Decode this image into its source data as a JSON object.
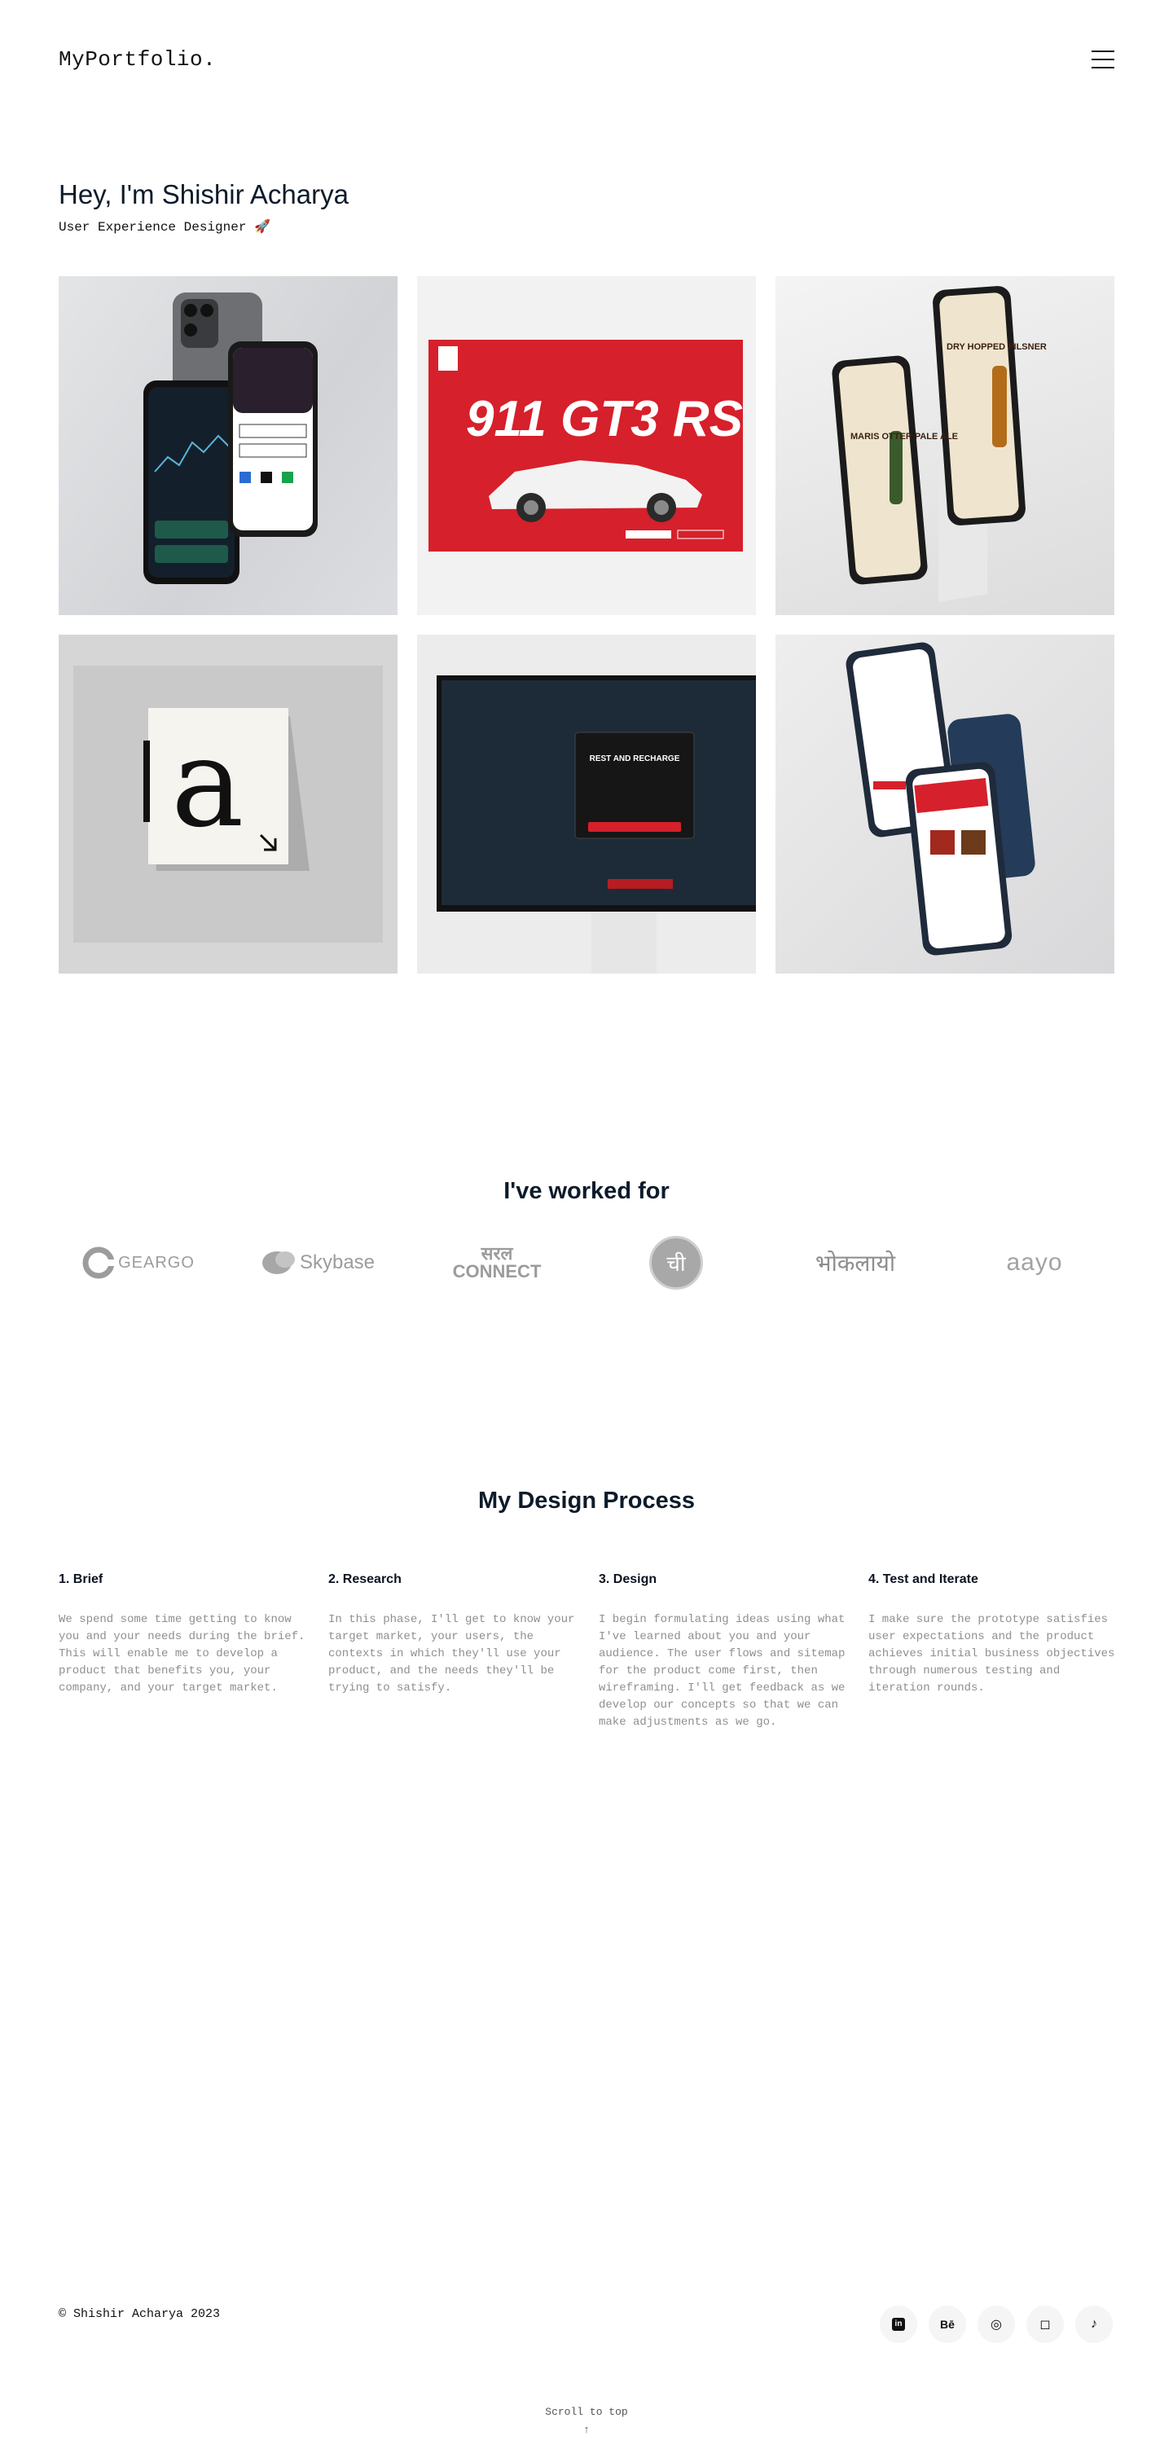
{
  "header": {
    "logo": "MyPortfolio."
  },
  "hero": {
    "title": "Hey, I'm Shishir Acharya",
    "subtitle": "User Experience Designer 🚀"
  },
  "projects": [
    {
      "name": "banking-app-mockup",
      "icon": "phone-mockup"
    },
    {
      "name": "porsche-911-gt3-rs",
      "text": "911 GT3 RS"
    },
    {
      "name": "beer-app-mockup",
      "text_a": "MARIS OTTER PALE ALE",
      "text_b": "DRY HOPPED PILSNER"
    },
    {
      "name": "letter-a-sign",
      "text": "a"
    },
    {
      "name": "game-rest-recharge",
      "text": "REST AND RECHARGE"
    },
    {
      "name": "food-app-mockup",
      "icon": "phone-mockup"
    }
  ],
  "worked_for": {
    "title": "I've worked for",
    "clients": [
      "GEARGO",
      "Skybase",
      "सरल CONNECT",
      "ची",
      "भोकलायो",
      "aayo"
    ]
  },
  "process": {
    "title": "My Design Process",
    "steps": [
      {
        "title": "1. Brief",
        "body": "We spend some time getting to know you and your needs during the brief. This will enable me to develop a product that benefits you, your company, and your target market."
      },
      {
        "title": "2. Research",
        "body": "In this phase, I'll get to know your target market, your users, the contexts in which they'll use your product, and the needs they'll be trying to satisfy."
      },
      {
        "title": "3. Design",
        "body": "I begin formulating ideas using what I've learned about you and your audience. The user flows and sitemap for the product come first, then wireframing. I'll get feedback as we develop our concepts so that we can make adjustments as we go."
      },
      {
        "title": "4. Test and Iterate",
        "body": "I make sure the prototype satisfies user expectations and the product achieves initial business objectives through numerous testing and iteration rounds."
      }
    ]
  },
  "footer": {
    "copyright": "© Shishir Acharya 2023",
    "socials": [
      {
        "name": "linkedin",
        "glyph": "in"
      },
      {
        "name": "behance",
        "glyph": "Bē"
      },
      {
        "name": "dribbble",
        "glyph": "◎"
      },
      {
        "name": "instagram",
        "glyph": "◻"
      },
      {
        "name": "tiktok",
        "glyph": "♪"
      }
    ],
    "scroll_top": "Scroll to top",
    "scroll_arrow": "↑"
  },
  "colors": {
    "accent_red": "#d6202b",
    "ink": "#0d1b2a",
    "muted": "#8f8f8f"
  }
}
